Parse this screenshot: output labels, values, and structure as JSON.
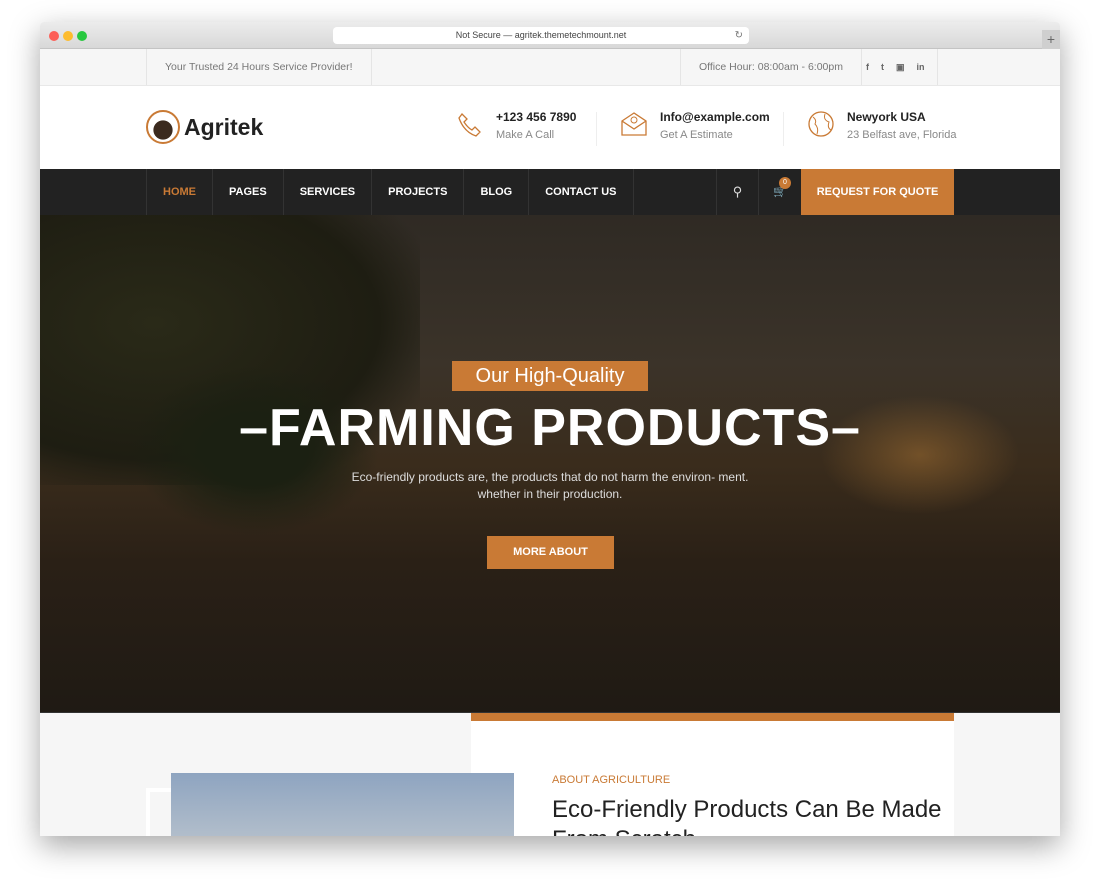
{
  "browser": {
    "url": "Not Secure — agritek.themetechmount.net"
  },
  "topbar": {
    "tagline": "Your Trusted 24 Hours Service Provider!",
    "office_hour": "Office Hour: 08:00am - 6:00pm",
    "social": [
      "f",
      "t",
      "in-square",
      "in"
    ]
  },
  "header": {
    "logo": "Agritek",
    "contacts": [
      {
        "title": "+123 456 7890",
        "sub": "Make A Call",
        "icon": "phone-icon"
      },
      {
        "title": "Info@example.com",
        "sub": "Get A Estimate",
        "icon": "envelope-icon"
      },
      {
        "title": "Newyork USA",
        "sub": "23 Belfast ave, Florida",
        "icon": "globe-icon"
      }
    ]
  },
  "nav": {
    "items": [
      "HOME",
      "PAGES",
      "SERVICES",
      "PROJECTS",
      "BLOG",
      "CONTACT US"
    ],
    "cart_count": "0",
    "quote": "REQUEST FOR QUOTE"
  },
  "hero": {
    "tag": "Our High-Quality",
    "title": "FARMING PRODUCTS",
    "subtitle": "Eco-friendly products are, the products that do not harm the environ- ment. whether in their production.",
    "button": "MORE ABOUT"
  },
  "about": {
    "kicker": "ABOUT AGRICULTURE",
    "title": "Eco-Friendly Products Can Be Made From Scratch"
  },
  "colors": {
    "accent": "#c97a35",
    "nav": "#222222"
  }
}
